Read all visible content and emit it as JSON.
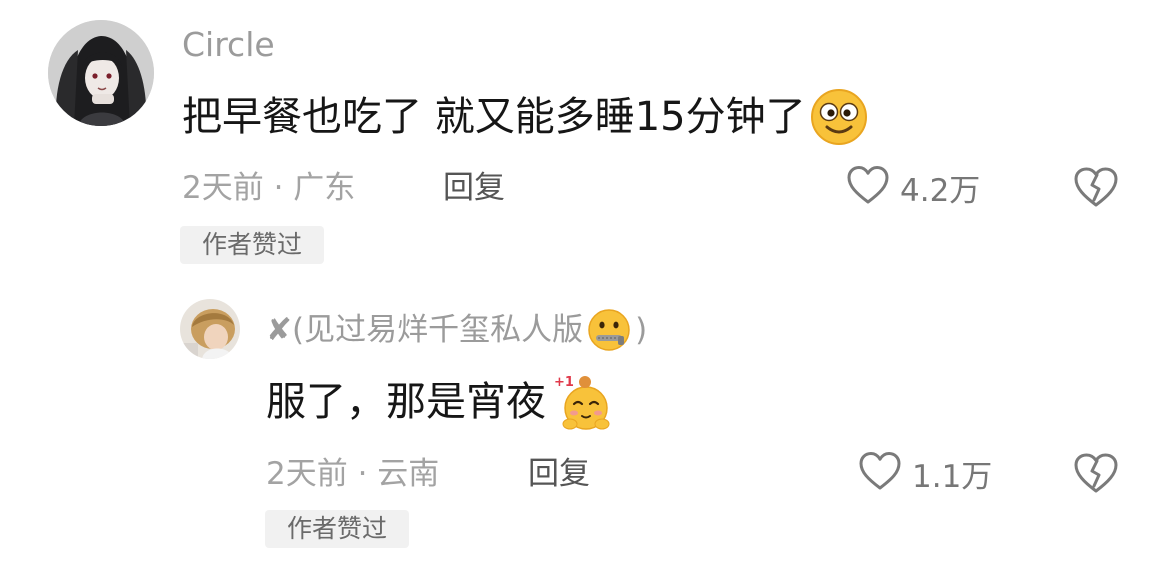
{
  "comments": [
    {
      "author": "Circle",
      "text": "把早餐也吃了 就又能多睡15分钟了",
      "emoji": "goofy-face-emoji",
      "time_location": "2天前 · 广东",
      "reply_label": "回复",
      "likes": "4.2万",
      "badge": "作者赞过"
    },
    {
      "author": "✘(见过易烊千玺私人版",
      "author_emoji": "zipper-mouth-emoji",
      "author_suffix": ")",
      "text": "服了，那是宵夜",
      "emoji": "plus-one-face-emoji",
      "time_location": "2天前 · 云南",
      "reply_label": "回复",
      "likes": "1.1万",
      "badge": "作者赞过"
    }
  ],
  "icons": {
    "like": "heart-outline-icon",
    "dislike": "broken-heart-icon"
  },
  "colors": {
    "text_primary": "#161616",
    "text_secondary": "#9b9b9b",
    "badge_bg": "#f1f1f1",
    "icon_stroke": "#7a7a7a"
  }
}
